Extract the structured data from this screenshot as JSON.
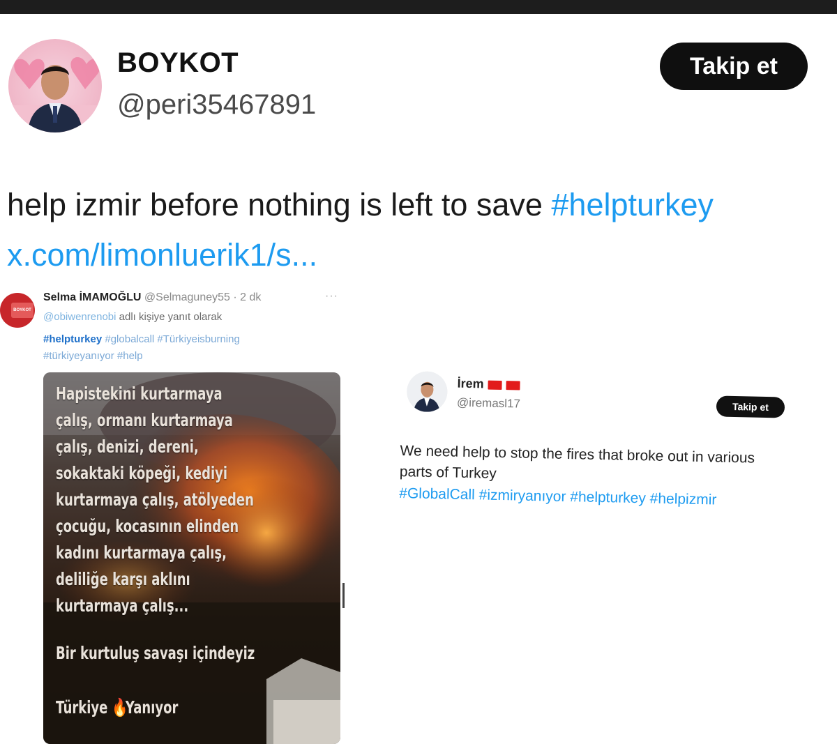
{
  "main_tweet": {
    "display_name": "BOYKOT",
    "handle": "@peri35467891",
    "follow_label": "Takip et",
    "text_plain": "help izmir before nothing is left to save ",
    "text_hashtag": "#helpturkey",
    "link": "x.com/limonluerik1/s..."
  },
  "embedded_tweet_1": {
    "name": "Selma İMAMOĞLU",
    "handle_time": "@Selmaguney55 · 2 dk",
    "more": "···",
    "reply_handle": "@obiwenrenobi",
    "reply_suffix": " adlı kişiye yanıt olarak",
    "tag_bold": "#helpturkey",
    "tags_line1": " #globalcall #Türkiyeisburning",
    "tags_line2": "#türkiyeyanıyor #help",
    "image_text": [
      "Hapistekini kurtarmaya",
      "çalış, ormanı kurtarmaya",
      "çalış, denizi, dereni,",
      "sokaktaki köpeği, kediyi",
      "kurtarmaya çalış, atölyeden",
      "çocuğu, kocasının elinden",
      "kadını kurtarmaya çalış,",
      "deliliğe karşı aklını",
      "kurtarmaya çalış..."
    ],
    "image_line2": "Bir kurtuluş savaşı içindeyiz",
    "image_line3_a": "Türkiye",
    "image_line3_emoji": "🔥",
    "image_line3_b": "Yanıyor",
    "avatar_badge": "BOYKOT"
  },
  "embedded_tweet_2": {
    "name": "İrem",
    "handle": "@iremasl17",
    "follow_label": "Takip et",
    "text": "We need help to stop the fires that broke out in various parts of Turkey",
    "tags": "#GlobalCall #izmiryanıyor  #helpturkey #helpizmir"
  },
  "colors": {
    "link": "#1d9bf0",
    "button_bg": "#0f0f0f"
  }
}
